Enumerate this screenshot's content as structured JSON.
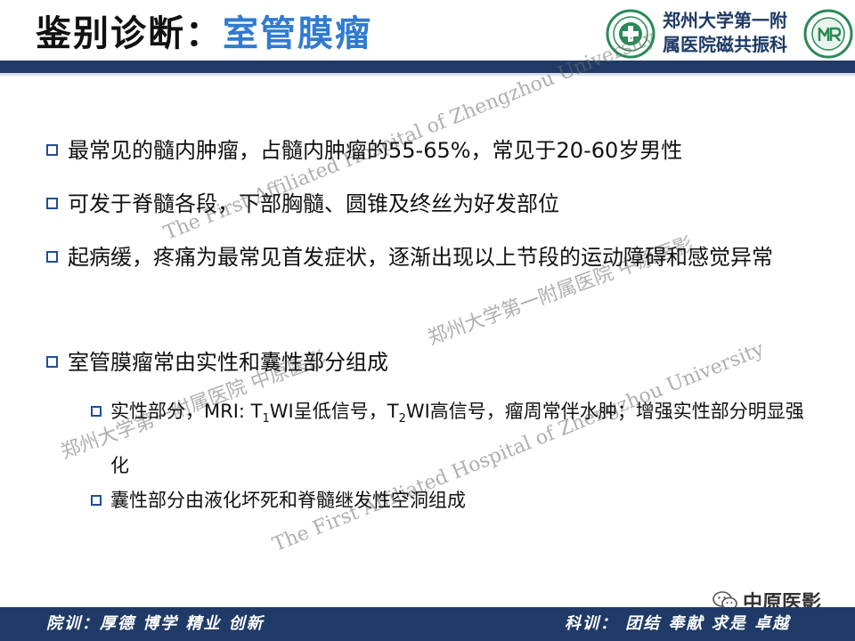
{
  "header": {
    "title_prefix": "鉴别诊断：",
    "title_accent": "室管膜瘤",
    "hospital_line1": "郑州大学第一附",
    "hospital_line2": "属医院磁共振科"
  },
  "bullets": [
    "最常见的髓内肿瘤，占髓内肿瘤的55-65%，常见于20-60岁男性",
    "可发于脊髓各段，下部胸髓、圆锥及终丝为好发部位",
    "起病缓，疼痛为最常见首发症状，逐渐出现以上节段的运动障碍和感觉异常",
    "室管膜瘤常由实性和囊性部分组成"
  ],
  "sub_bullets": [
    {
      "part1": "实性部分，MRI: T",
      "sub1": "1",
      "part2": "WI呈低信号，T",
      "sub2": "2",
      "part3": "WI高信号，瘤周常伴水肿；增强实性部分明显强化"
    },
    {
      "text": "囊性部分由液化坏死和脊髓继发性空洞组成"
    }
  ],
  "watermarks": {
    "en": "The First Affiliated Hospital of Zhengzhou University",
    "cn": "郑州大学第一附属医院",
    "brand": "中原医影"
  },
  "footer": {
    "left": "院训：厚德 博学 精业 创新",
    "right": "科训： 团结 奉献 求是 卓越",
    "brand": "中原医影"
  },
  "colors": {
    "accent": "#2f7bd1",
    "navy": "#1f3a66",
    "logo_green": "#2a8a57"
  }
}
